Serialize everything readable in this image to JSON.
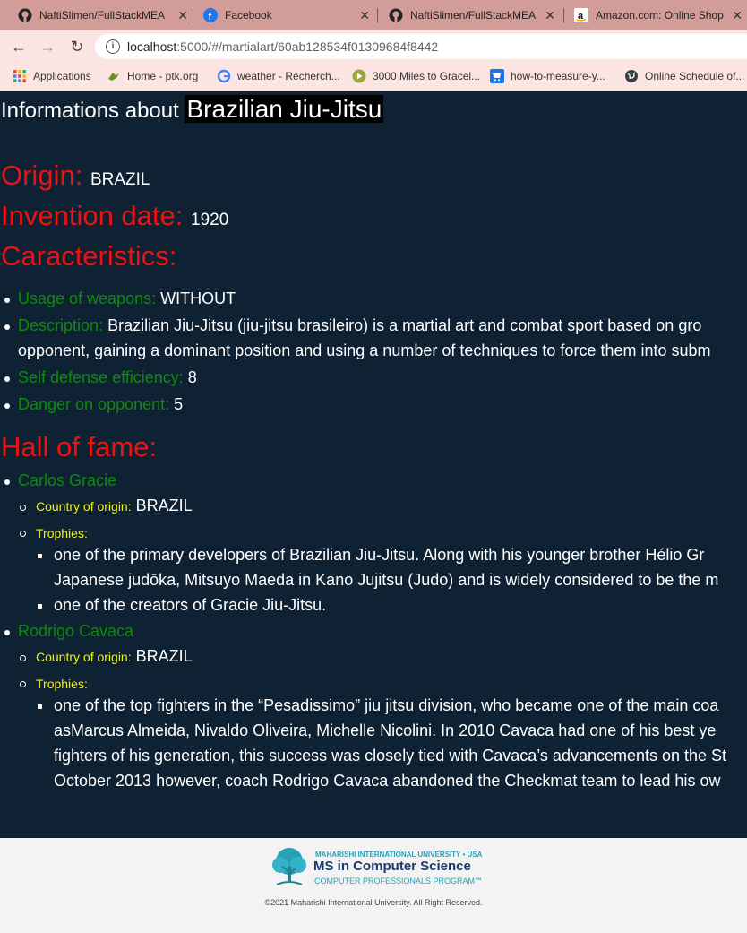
{
  "browser": {
    "tabs": [
      {
        "title": "NaftiSlimen/FullStackMEA",
        "icon": "github-icon"
      },
      {
        "title": "Facebook",
        "icon": "facebook-icon"
      },
      {
        "title": "NaftiSlimen/FullStackMEA",
        "icon": "github-icon"
      },
      {
        "title": "Amazon.com: Online Shop",
        "icon": "amazon-icon"
      }
    ],
    "url_host": "localhost",
    "url_rest": ":5000/#/martialart/60ab128534f01309684f8442",
    "bookmarks": [
      {
        "label": "Applications",
        "icon": "apps-grid-icon"
      },
      {
        "label": "Home - ptk.org",
        "icon": "bird-icon"
      },
      {
        "label": "weather - Recherch...",
        "icon": "google-icon"
      },
      {
        "label": "3000 Miles to Gracel...",
        "icon": "play-icon"
      },
      {
        "label": "how-to-measure-y...",
        "icon": "cart-icon"
      },
      {
        "label": "Online Schedule of...",
        "icon": "globe-icon"
      }
    ]
  },
  "page": {
    "heading_prefix": "Informations about",
    "art_name": "Brazilian Jiu-Jitsu",
    "origin_label": "Origin:",
    "origin_value": "BRAZIL",
    "invention_label": "Invention date:",
    "invention_value": "1920",
    "caracteristics_label": "Caracteristics:",
    "weapons_label": "Usage of weapons:",
    "weapons_value": "WITHOUT",
    "description_label": "Description:",
    "description_line1": "Brazilian Jiu-Jitsu (jiu-jitsu brasileiro) is a martial art and combat sport based on gro",
    "description_line2": "opponent, gaining a dominant position and using a number of techniques to force them into subm",
    "selfdef_label": "Self defense efficiency:",
    "selfdef_value": "8",
    "danger_label": "Danger on opponent:",
    "danger_value": "5",
    "hall_label": "Hall of fame:",
    "fighters": [
      {
        "name": "Carlos Gracie",
        "country_label": "Country of origin:",
        "country": "BRAZIL",
        "trophies_label": "Trophies:",
        "trophies": [
          "one of the primary developers of Brazilian Jiu-Jitsu. Along with his younger brother Hélio Gr",
          "Japanese judōka, Mitsuyo Maeda in Kano Jujitsu (Judo) and is widely considered to be the m",
          "one of the creators of Gracie Jiu-Jitsu."
        ]
      },
      {
        "name": "Rodrigo Cavaca",
        "country_label": "Country of origin:",
        "country": "BRAZIL",
        "trophies_label": "Trophies:",
        "trophies": [
          "one of the top fighters in the “Pesadissimo” jiu jitsu division, who became one of the main coa",
          "asMarcus Almeida, Nivaldo Oliveira, Michelle Nicolini. In 2010 Cavaca had one of his best ye",
          "fighters of his generation, this success was closely tied with Cavaca’s advancements on the St",
          "October 2013 however, coach Rodrigo Cavaca abandoned the Checkmat team to lead his ow"
        ]
      }
    ]
  },
  "footer": {
    "uni_name": "MAHARISHI INTERNATIONAL UNIVERSITY • USA",
    "program": "MS in Computer Science",
    "program_sub": "COMPUTER PROFESSIONALS PROGRAM℠",
    "copyright": "©2021 Maharishi International University. All Right Reserved."
  },
  "colors": {
    "page_bg": "#0f2233",
    "label_red": "#ee1111",
    "label_green": "#0f8a0f",
    "label_yellow": "#f2f200",
    "tab_strip": "#d29c98",
    "toolbar": "#fbe5e3"
  }
}
